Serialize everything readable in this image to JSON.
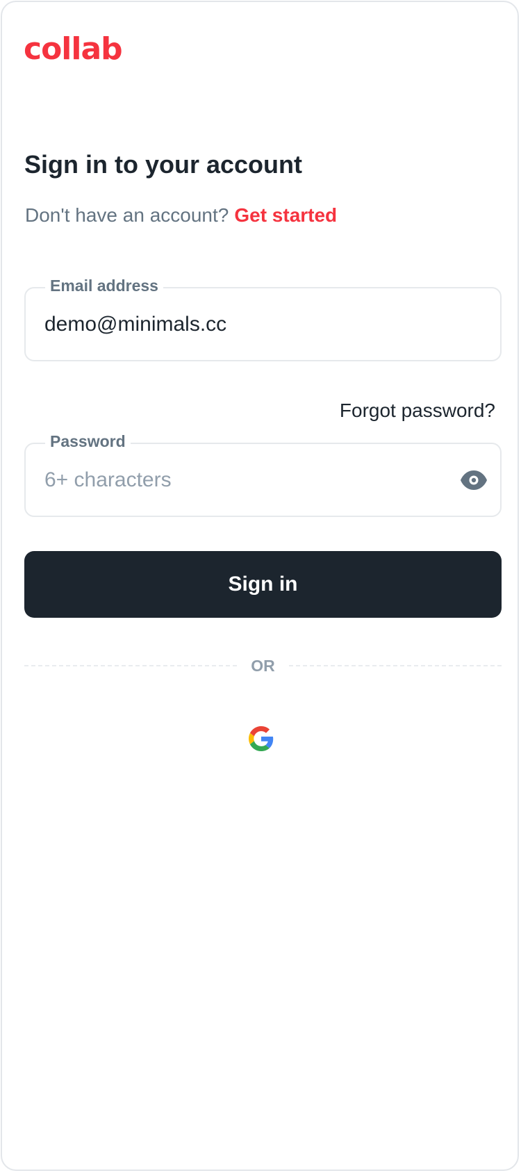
{
  "brand": {
    "logo_text": "collab",
    "accent_color": "#f5333f"
  },
  "heading": {
    "title": "Sign in to your account"
  },
  "signup": {
    "prompt": "Don't have an account?",
    "link_label": "Get started"
  },
  "email_field": {
    "label": "Email address",
    "value": "demo@minimals.cc"
  },
  "forgot_password_label": "Forgot password?",
  "password_field": {
    "label": "Password",
    "placeholder": "6+ characters",
    "toggle_icon": "eye-icon"
  },
  "sign_in_button_label": "Sign in",
  "divider_text": "OR",
  "social": {
    "google_icon": "google-icon"
  },
  "colors": {
    "primary_dark": "#1c252e",
    "secondary_text": "#637381",
    "placeholder_text": "#919eab",
    "border": "#e6e9ec"
  }
}
